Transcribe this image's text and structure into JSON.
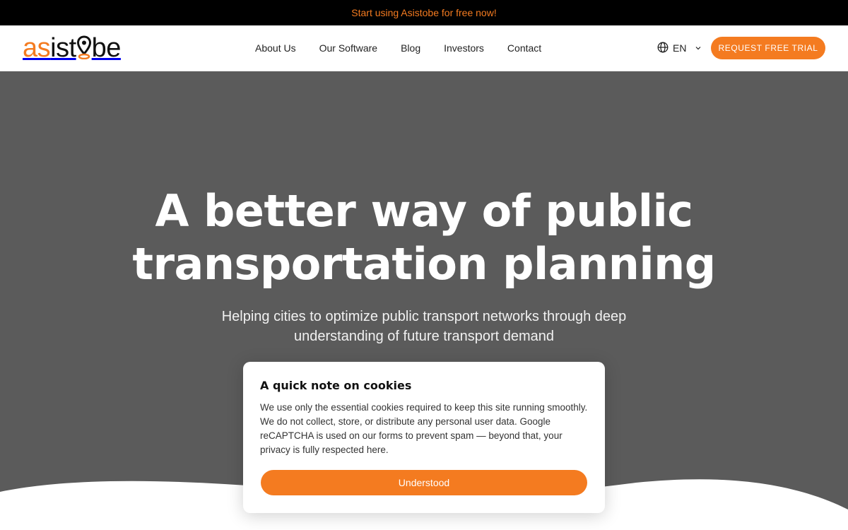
{
  "promo": {
    "text": "Start using Asistobe for free now!"
  },
  "brand": {
    "logo_part1": "as",
    "logo_part2": "ist",
    "logo_part3": "be",
    "accent_color": "#f47b20"
  },
  "nav": {
    "items": [
      {
        "label": "About Us"
      },
      {
        "label": "Our Software"
      },
      {
        "label": "Blog"
      },
      {
        "label": "Investors"
      },
      {
        "label": "Contact"
      }
    ]
  },
  "language": {
    "current": "EN",
    "icon": "globe-icon"
  },
  "header": {
    "cta_label": "REQUEST FREE TRIAL"
  },
  "hero": {
    "title_line1": "A better way of public",
    "title_line2": "transportation planning",
    "subtitle_line1": "Helping cities to optimize public transport networks through deep",
    "subtitle_line2": "understanding of future transport demand"
  },
  "cookie_notice": {
    "title": "A quick note on cookies",
    "text_before_link": "We use only the essential cookies required to keep this site running smoothly. We do not collect, store, or distribute any personal user data. Google reCAPTCHA is used on our forms to prevent spam — beyond that, your privacy is fully respected ",
    "link_text": "here",
    "text_after_link": ".",
    "button_label": "Understood"
  }
}
